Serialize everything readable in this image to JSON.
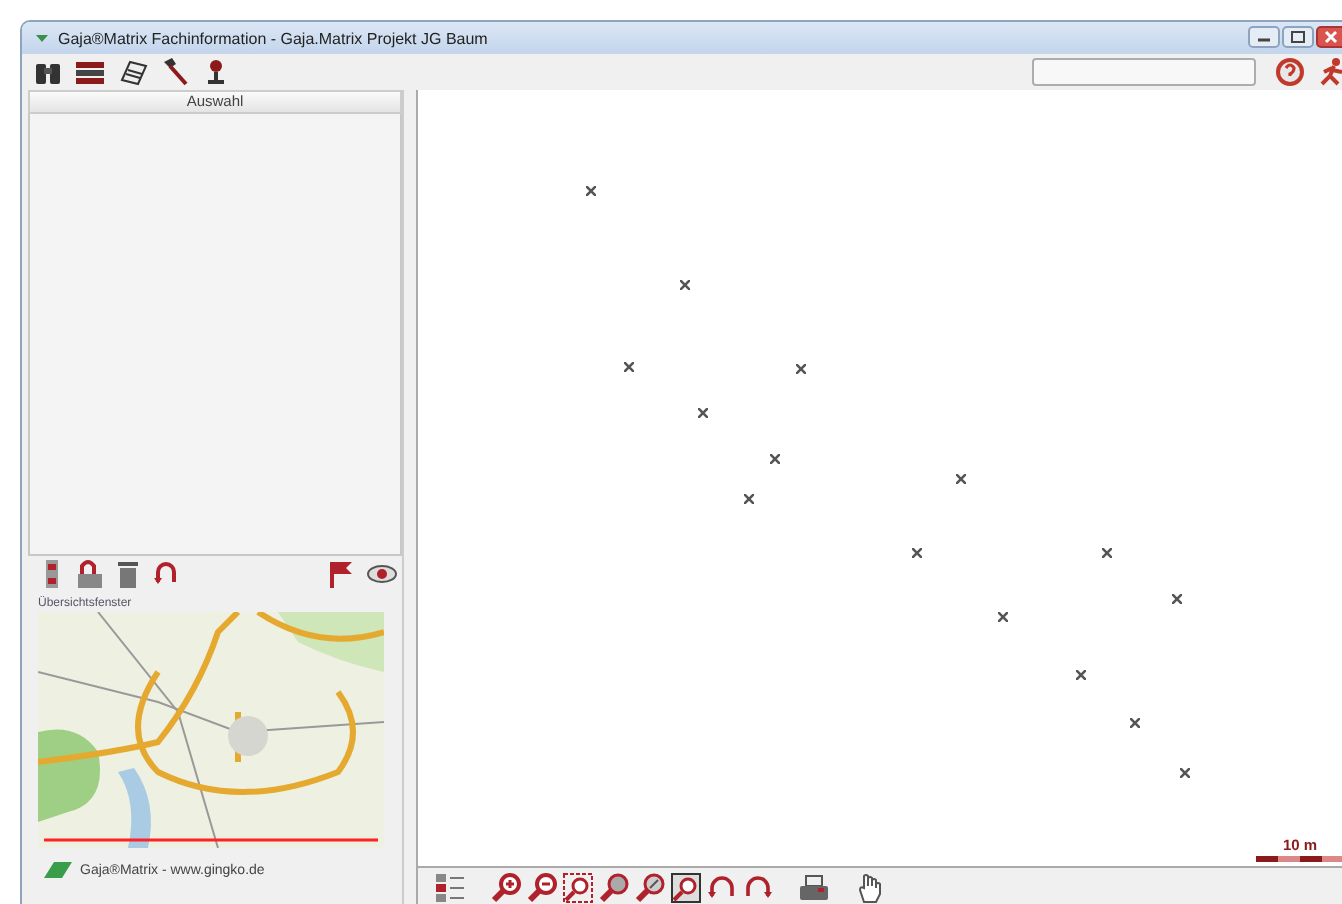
{
  "window": {
    "title": "Gaja®Matrix Fachinformation - Gaja.Matrix Projekt JG Baum"
  },
  "sidebar": {
    "header": "Auswahl",
    "overview_label": "Übersichtsfenster",
    "footer": "Gaja®Matrix - www.gingko.de"
  },
  "map": {
    "scale_label": "10 m"
  }
}
